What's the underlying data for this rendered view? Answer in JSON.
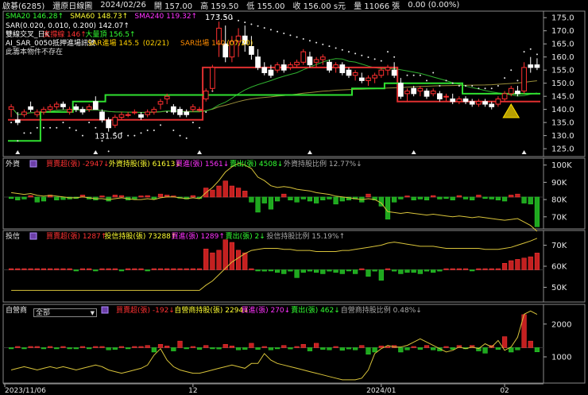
{
  "header": {
    "symbol": "啟碁(6285)",
    "mode": "還原日線圖",
    "date": "2024/02/26",
    "open_label": "開",
    "open": "157.00",
    "high_label": "高",
    "high": "159.50",
    "low_label": "低",
    "low": "155.00",
    "close_label": "收",
    "close": "156.00",
    "unit": "s元",
    "vol_label": "量",
    "volume": "11066",
    "vol_unit": "張",
    "change": "0.00 (0.00%)"
  },
  "price_panel": {
    "legend_row1": [
      {
        "text": "SMA20 146.28",
        "color": "#32ff32",
        "arrow": "↑"
      },
      {
        "text": "SMA60 148.73",
        "color": "#ffff32",
        "arrow": "↑"
      },
      {
        "text": "SMA240 119.32",
        "color": "#ff32ff",
        "arrow": "↑"
      }
    ],
    "legend_row2": {
      "text": "SAR(0.020, 0.010, 0.200) 142.07",
      "color": "#ffffff",
      "arrow": "↑"
    },
    "legend_row3": [
      {
        "text": "雙線交叉_日K",
        "color": "#ffffff"
      },
      {
        "text": "支撐線 146",
        "color": "#ff3232",
        "arrow": "↑"
      },
      {
        "text": "大量頂 156.5",
        "color": "#32ff32",
        "arrow": "↑"
      }
    ],
    "legend_row4": [
      {
        "text": "AI_SAR_0050抵押進場訊號",
        "color": "#ffffff"
      },
      {
        "text": "SAR進場 145.5",
        "color": "#ffd000"
      },
      {
        "text": "(02/21)",
        "color": "#ffd000"
      },
      {
        "text": "SAR出場 140",
        "color": "#ff8c00"
      },
      {
        "text": "(07/20)",
        "color": "#ffd000"
      }
    ],
    "legend_row5": {
      "text": "此籌本物件不存在",
      "color": "#dddddd"
    },
    "annotations": {
      "high": "173.50",
      "low": "131.50"
    }
  },
  "foreign_panel": {
    "title": "外資",
    "legend": [
      {
        "text": "買賣超(張) -2947",
        "color": "#ff3232",
        "arrow": "↓"
      },
      {
        "text": "外資持股(張) 61613",
        "color": "#ffff32",
        "arrow": "↓"
      },
      {
        "text": "買進(張) 1561",
        "color": "#ff32ff",
        "arrow": "↓"
      },
      {
        "text": "賣出(張) 4508",
        "color": "#32ff32",
        "arrow": "↓"
      },
      {
        "text": "外資持股比例 12.77%",
        "color": "#aaaaaa",
        "arrow": "↓"
      }
    ]
  },
  "trust_panel": {
    "title": "投信",
    "legend": [
      {
        "text": "買賣超(張) 1287",
        "color": "#ff3232",
        "arrow": "↑"
      },
      {
        "text": "投信持股(張) 73288",
        "color": "#ffff32",
        "arrow": "↑"
      },
      {
        "text": "買進(張) 1289",
        "color": "#ff32ff",
        "arrow": "↑"
      },
      {
        "text": "賣出(張) 2",
        "color": "#32ff32",
        "arrow": "↓"
      },
      {
        "text": "投信持股比例 15.19%",
        "color": "#aaaaaa",
        "arrow": "↑"
      }
    ]
  },
  "dealer_panel": {
    "title": "自營商",
    "select_value": "全部",
    "legend": [
      {
        "text": "買賣超(張) -192",
        "color": "#ff3232",
        "arrow": "↓"
      },
      {
        "text": "自營商持股(張) 2294",
        "color": "#ffff32",
        "arrow": "↓"
      },
      {
        "text": "買進(張) 270",
        "color": "#ff32ff",
        "arrow": "↓"
      },
      {
        "text": "賣出(張) 462",
        "color": "#32ff32",
        "arrow": "↓"
      },
      {
        "text": "自營商持股比例 0.48%",
        "color": "#aaaaaa",
        "arrow": "↓"
      }
    ]
  },
  "x_axis": {
    "labels": [
      "2023/11/06",
      "12",
      "2024/01",
      "02"
    ]
  },
  "chart_data": [
    {
      "type": "candlestick",
      "title": "啟碁(6285) 還原日線圖",
      "y_ticks": [
        125,
        130,
        135,
        140,
        145,
        150,
        155,
        160,
        165,
        170,
        175
      ],
      "ylim": [
        122,
        177.5
      ],
      "ohlc": [
        [
          140,
          142,
          137,
          141
        ],
        [
          136,
          139,
          134,
          135
        ],
        [
          138,
          140,
          137,
          139
        ],
        [
          141,
          143,
          139,
          140
        ],
        [
          138,
          140,
          137,
          139
        ],
        [
          139,
          141,
          138,
          140
        ],
        [
          140,
          142,
          139,
          141
        ],
        [
          141,
          143,
          140,
          142
        ],
        [
          142,
          143,
          140,
          141
        ],
        [
          139,
          141,
          138,
          140
        ],
        [
          141,
          142,
          139,
          140
        ],
        [
          140,
          141,
          138,
          139
        ],
        [
          140,
          142,
          139,
          141
        ],
        [
          143,
          145,
          140,
          140
        ],
        [
          139,
          140,
          135,
          136
        ],
        [
          136,
          137,
          131.5,
          133
        ],
        [
          134,
          138,
          133,
          137
        ],
        [
          137,
          139,
          136,
          138
        ],
        [
          138,
          139,
          137,
          138
        ],
        [
          139,
          140,
          138,
          139
        ],
        [
          138,
          139,
          136,
          137
        ],
        [
          138,
          140,
          137,
          139
        ],
        [
          139,
          141,
          138,
          140
        ],
        [
          142,
          144,
          140,
          143
        ],
        [
          144,
          146,
          142,
          145
        ],
        [
          141,
          142,
          138,
          139
        ],
        [
          140,
          141,
          137,
          138
        ],
        [
          139,
          140,
          137,
          138
        ],
        [
          140,
          142,
          139,
          141
        ],
        [
          140,
          141,
          139,
          140
        ],
        [
          144,
          148,
          143,
          147
        ],
        [
          148,
          157,
          147,
          156
        ],
        [
          165,
          173.5,
          160,
          171
        ],
        [
          165,
          172,
          158,
          160
        ],
        [
          160,
          168,
          158,
          166
        ],
        [
          166,
          171,
          160,
          168
        ],
        [
          168,
          172,
          162,
          165
        ],
        [
          164,
          168,
          159,
          161
        ],
        [
          160,
          163,
          155,
          156
        ],
        [
          156,
          158,
          153,
          154
        ],
        [
          155,
          157,
          152,
          153
        ],
        [
          155,
          158,
          154,
          157
        ],
        [
          157,
          159,
          154,
          155
        ],
        [
          156,
          158,
          155,
          157
        ],
        [
          157,
          159,
          156,
          158
        ],
        [
          158,
          163,
          157,
          162
        ],
        [
          160,
          162,
          156,
          157
        ],
        [
          158,
          160,
          156,
          159
        ],
        [
          159,
          161,
          157,
          160
        ],
        [
          158,
          159,
          154,
          155
        ],
        [
          156,
          158,
          154,
          157
        ],
        [
          157,
          158,
          153,
          154
        ],
        [
          155,
          156,
          152,
          153
        ],
        [
          153,
          155,
          151,
          154
        ],
        [
          152,
          154,
          150,
          151
        ],
        [
          151,
          153,
          149,
          152
        ],
        [
          152,
          154,
          150,
          153
        ],
        [
          153,
          156,
          152,
          155
        ],
        [
          155,
          157,
          153,
          156
        ],
        [
          155,
          158,
          152,
          153
        ],
        [
          150,
          152,
          144,
          145
        ],
        [
          146,
          148,
          143,
          147
        ],
        [
          148,
          149,
          145,
          146
        ],
        [
          147,
          149,
          145,
          148
        ],
        [
          147,
          148,
          144,
          145
        ],
        [
          146,
          148,
          145,
          147
        ],
        [
          146,
          147,
          143,
          144
        ],
        [
          145,
          146,
          143,
          145
        ],
        [
          144,
          146,
          142,
          143
        ],
        [
          143,
          145,
          142,
          144
        ],
        [
          144,
          145,
          142,
          143
        ],
        [
          143,
          144,
          141,
          142
        ],
        [
          142,
          144,
          141,
          143
        ],
        [
          143,
          144,
          141,
          142
        ],
        [
          142,
          143,
          140,
          141
        ],
        [
          142,
          145,
          141,
          144
        ],
        [
          144,
          147,
          143,
          146
        ],
        [
          146,
          149,
          145,
          148
        ],
        [
          147,
          149,
          145,
          146
        ],
        [
          147,
          158,
          146,
          156
        ],
        [
          157,
          160,
          154,
          156
        ],
        [
          157,
          159.5,
          155,
          156
        ]
      ]
    },
    {
      "type": "bar+line",
      "title": "外資",
      "y_ticks_label": [
        "70K",
        "80K",
        "90K",
        "100K"
      ],
      "y_ticks": [
        70000,
        80000,
        90000,
        100000
      ],
      "ylim": [
        63000,
        104000
      ],
      "bars": [
        -150,
        -300,
        -200,
        150,
        -500,
        -400,
        200,
        -300,
        -250,
        -200,
        -150,
        200,
        -200,
        -300,
        100,
        -400,
        200,
        150,
        -300,
        -200,
        100,
        150,
        -200,
        300,
        200,
        100,
        -100,
        -200,
        150,
        -150,
        900,
        700,
        1100,
        1600,
        1100,
        900,
        600,
        -500,
        -1500,
        -600,
        -1200,
        -400,
        300,
        -300,
        -500,
        -200,
        -400,
        -600,
        -300,
        -200,
        -700,
        -400,
        -300,
        -200,
        -500,
        300,
        -300,
        -900,
        -2200,
        -500,
        -200,
        100,
        -300,
        -200,
        -300,
        150,
        -200,
        -150,
        -300,
        150,
        -200,
        -300,
        200,
        -150,
        -200,
        -300,
        -400,
        200,
        300,
        -600,
        -700,
        -2947
      ],
      "holding": [
        84000,
        83500,
        83000,
        83500,
        82500,
        82000,
        82500,
        82000,
        81500,
        81000,
        81000,
        81500,
        81000,
        80500,
        80500,
        80000,
        80500,
        81000,
        80500,
        80000,
        80000,
        80500,
        80000,
        81000,
        81500,
        81500,
        81000,
        80500,
        81000,
        80500,
        84000,
        87000,
        91000,
        96000,
        99000,
        101000,
        100000,
        98000,
        93000,
        91000,
        88000,
        87000,
        87500,
        87000,
        86000,
        85500,
        85000,
        84000,
        83500,
        83000,
        82000,
        81500,
        81000,
        80500,
        80000,
        80500,
        80000,
        78000,
        73000,
        72500,
        72000,
        72500,
        72000,
        71500,
        71000,
        71500,
        71000,
        70500,
        70000,
        70500,
        70000,
        69500,
        70000,
        69500,
        69000,
        68500,
        68000,
        68500,
        69000,
        67000,
        65000,
        61613
      ]
    },
    {
      "type": "bar+line",
      "title": "投信",
      "y_ticks_label": [
        "50K",
        "60K",
        "70K"
      ],
      "y_ticks": [
        50000,
        60000,
        70000
      ],
      "ylim": [
        43000,
        77000
      ],
      "bars": [
        50,
        50,
        50,
        50,
        50,
        50,
        0,
        50,
        0,
        0,
        -30,
        0,
        0,
        -50,
        0,
        0,
        0,
        -30,
        0,
        0,
        0,
        -30,
        0,
        0,
        0,
        0,
        0,
        0,
        0,
        0,
        1600,
        1300,
        1500,
        2300,
        2100,
        1500,
        1300,
        0,
        -50,
        -100,
        -30,
        -200,
        -300,
        -100,
        -600,
        -200,
        -100,
        -200,
        -300,
        -100,
        -200,
        -300,
        -50,
        -300,
        0,
        -500,
        -100,
        -800,
        0,
        -100,
        -300,
        -200,
        -200,
        -300,
        -100,
        -200,
        -100,
        0,
        0,
        0,
        0,
        -50,
        0,
        0,
        0,
        0,
        500,
        700,
        800,
        900,
        1000,
        1287
      ],
      "holding": [
        48500,
        48500,
        48500,
        48500,
        48500,
        48500,
        48500,
        48500,
        48500,
        48500,
        48500,
        48500,
        48500,
        48500,
        48500,
        48500,
        48500,
        48500,
        48500,
        48500,
        48500,
        48500,
        48500,
        48500,
        48500,
        48500,
        48500,
        48500,
        48500,
        48500,
        51000,
        53000,
        56000,
        59000,
        62000,
        64000,
        66000,
        67500,
        68000,
        68500,
        68500,
        68500,
        68000,
        68000,
        67500,
        67500,
        67500,
        67000,
        67000,
        67000,
        67000,
        67500,
        67500,
        68000,
        68500,
        69000,
        69500,
        70000,
        71000,
        71500,
        71000,
        70500,
        70000,
        69500,
        69500,
        69500,
        69000,
        68500,
        68500,
        68500,
        68500,
        68500,
        68500,
        68000,
        68000,
        68000,
        68500,
        69000,
        70000,
        71000,
        72000,
        73288
      ]
    },
    {
      "type": "bar+line",
      "title": "自營商",
      "y_ticks_label": [
        "1000",
        "2000"
      ],
      "y_ticks": [
        1000,
        2000
      ],
      "ylim": [
        200,
        2600
      ],
      "bars": [
        -50,
        50,
        -50,
        50,
        50,
        -50,
        50,
        -50,
        50,
        -50,
        -30,
        50,
        -50,
        50,
        50,
        -100,
        -80,
        50,
        -50,
        50,
        50,
        100,
        -200,
        150,
        80,
        -150,
        300,
        -50,
        50,
        -80,
        100,
        -50,
        -60,
        150,
        80,
        -100,
        -80,
        200,
        -80,
        50,
        -100,
        -50,
        100,
        -60,
        50,
        150,
        -150,
        200,
        -80,
        -100,
        50,
        -120,
        -60,
        -100,
        100,
        -300,
        -200,
        80,
        50,
        100,
        -200,
        -100,
        50,
        -80,
        100,
        -100,
        -150,
        50,
        -80,
        100,
        -50,
        100,
        -150,
        -250,
        100,
        -80,
        500,
        -200,
        -100,
        1500,
        300,
        -192
      ],
      "holding": [
        600,
        650,
        700,
        650,
        600,
        650,
        700,
        650,
        700,
        650,
        600,
        650,
        700,
        750,
        700,
        600,
        550,
        500,
        550,
        600,
        650,
        750,
        1050,
        1250,
        900,
        700,
        600,
        550,
        500,
        500,
        550,
        600,
        650,
        700,
        750,
        700,
        650,
        800,
        800,
        1100,
        900,
        800,
        750,
        700,
        650,
        600,
        550,
        500,
        450,
        400,
        350,
        300,
        300,
        300,
        350,
        600,
        1100,
        1250,
        1350,
        1300,
        1300,
        1350,
        1450,
        1550,
        1450,
        1350,
        1250,
        1150,
        1200,
        1300,
        1250,
        1300,
        1250,
        1400,
        1300,
        1500,
        1200,
        1300,
        1600,
        2300,
        2400,
        2294
      ]
    }
  ]
}
